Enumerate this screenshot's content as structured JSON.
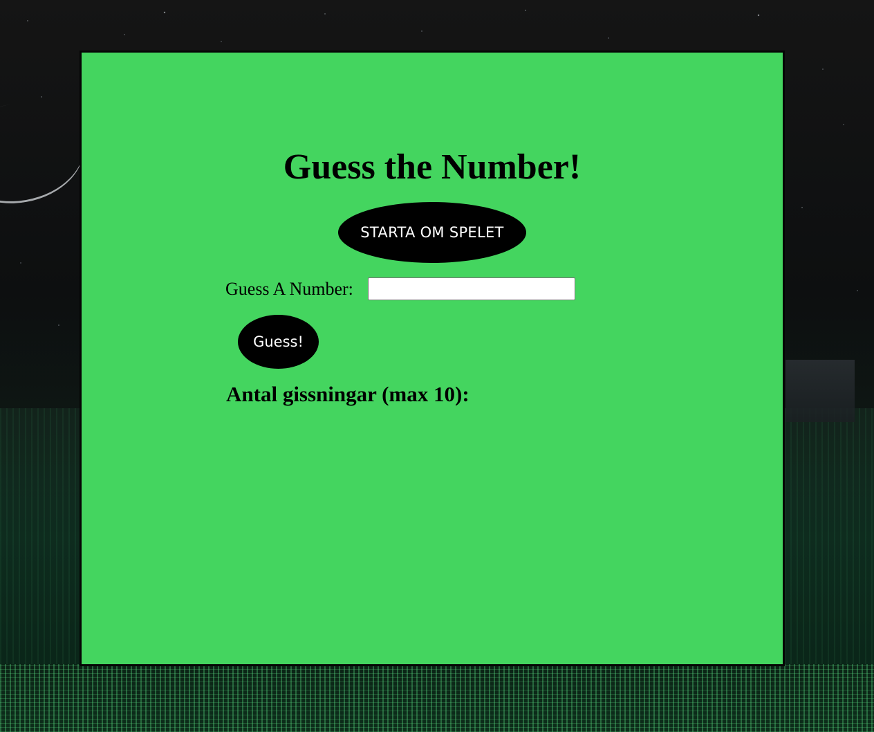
{
  "game": {
    "title": "Guess the Number!",
    "restart_label": "STARTA OM SPELET",
    "guess_field_label": "Guess A Number:",
    "guess_input_value": "",
    "guess_button_label": "Guess!",
    "guess_count_label": "Antal gissningar (max 10):"
  },
  "colors": {
    "panel_background": "#44d55f",
    "button_background": "#000000",
    "button_text": "#ffffff"
  }
}
